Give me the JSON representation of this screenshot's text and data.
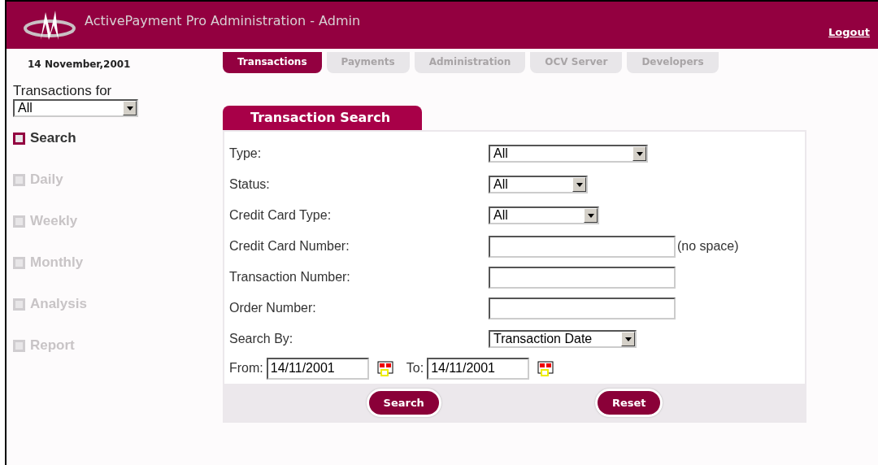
{
  "header": {
    "title": "ActivePayment Pro Administration - Admin",
    "logout": "Logout"
  },
  "date": "14 November,2001",
  "tabs": [
    {
      "label": "Transactions",
      "selected": true
    },
    {
      "label": "Payments",
      "selected": false
    },
    {
      "label": "Administration",
      "selected": false
    },
    {
      "label": "OCV Server",
      "selected": false
    },
    {
      "label": "Developers",
      "selected": false
    }
  ],
  "sidebar": {
    "label": "Transactions for",
    "select": "All",
    "items": [
      {
        "label": "Search",
        "selected": true
      },
      {
        "label": "Daily",
        "selected": false
      },
      {
        "label": "Weekly",
        "selected": false
      },
      {
        "label": "Monthly",
        "selected": false
      },
      {
        "label": "Analysis",
        "selected": false
      },
      {
        "label": "Report",
        "selected": false
      }
    ]
  },
  "form": {
    "title": "Transaction Search",
    "rows": [
      {
        "kind": "select",
        "label": "Type:",
        "value": "All"
      },
      {
        "kind": "select",
        "label": "Status:",
        "value": "All"
      },
      {
        "kind": "select",
        "label": "Credit Card Type:",
        "value": "All"
      },
      {
        "kind": "input",
        "label": "Credit Card Number:",
        "note": "(no space)"
      },
      {
        "kind": "input",
        "label": "Transaction Number:"
      },
      {
        "kind": "input",
        "label": "Order Number:"
      },
      {
        "kind": "select",
        "label": "Search By:",
        "value": "Transaction Date"
      }
    ],
    "from": {
      "label": "From:",
      "value": "14/11/2001"
    },
    "to": {
      "label": "To:",
      "value": "14/11/2001"
    },
    "buttons": [
      "Search",
      "Reset"
    ]
  }
}
